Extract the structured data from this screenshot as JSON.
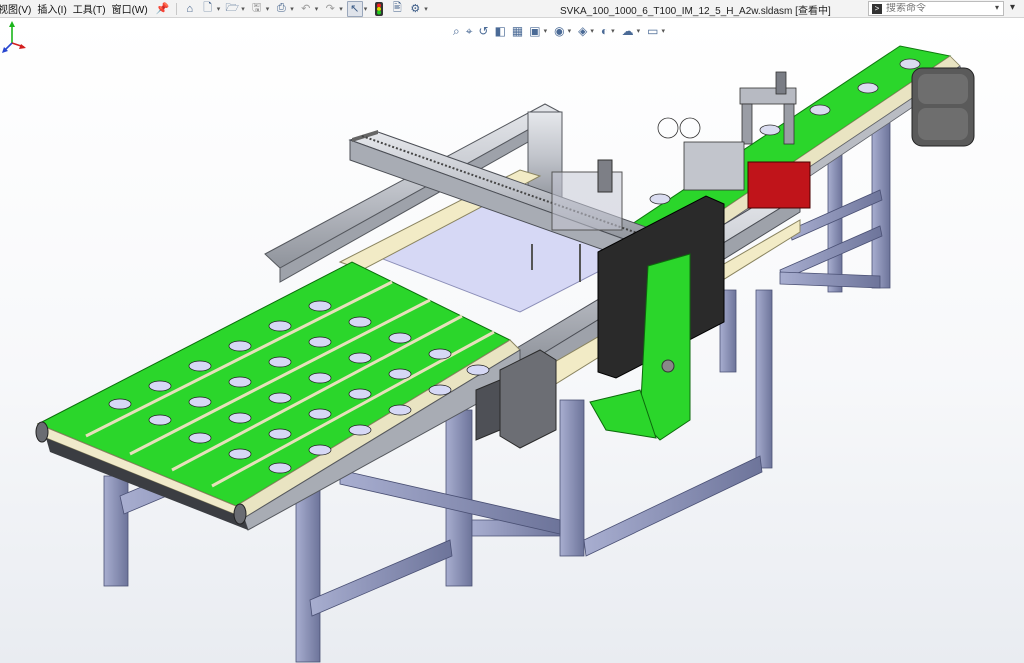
{
  "menu": {
    "items": [
      "视图(V)",
      "插入(I)",
      "工具(T)",
      "窗口(W)"
    ]
  },
  "toolbar": {
    "pin_icon": "pin-icon",
    "home_icon": "home-icon",
    "new_icon": "new-document-icon",
    "open_icon": "open-folder-icon",
    "save_icon": "save-icon",
    "print_icon": "print-icon",
    "undo_icon": "undo-icon",
    "redo_icon": "redo-icon",
    "select_icon": "select-arrow-icon",
    "traffic_icon": "rebuild-traffic-light-icon",
    "file_props_icon": "file-properties-icon",
    "options_icon": "options-gear-icon"
  },
  "document": {
    "title": "SVKA_100_1000_6_T100_IM_12_5_H_A2w.sldasm [查看中]"
  },
  "search": {
    "placeholder": "搜索命令"
  },
  "heads_up": {
    "icons": [
      "zoom-to-fit-icon",
      "zoom-area-icon",
      "previous-view-icon",
      "section-view-icon",
      "dynamic-annotation-icon",
      "view-orientation-icon",
      "display-style-icon",
      "hide-show-icon",
      "edit-appearance-icon",
      "scene-icon",
      "view-settings-icon"
    ]
  },
  "model": {
    "colors": {
      "belt_green": "#2bd62b",
      "belt_green_dark": "#17a417",
      "frame_blue": "#8e95b8",
      "frame_blue_dark": "#5d6487",
      "cream": "#f2ebc6",
      "aluminum": "#c9ccd2",
      "black_panel": "#2a2a2a",
      "red_block": "#c0141a",
      "lavender_plate": "#d6d8f5"
    }
  }
}
